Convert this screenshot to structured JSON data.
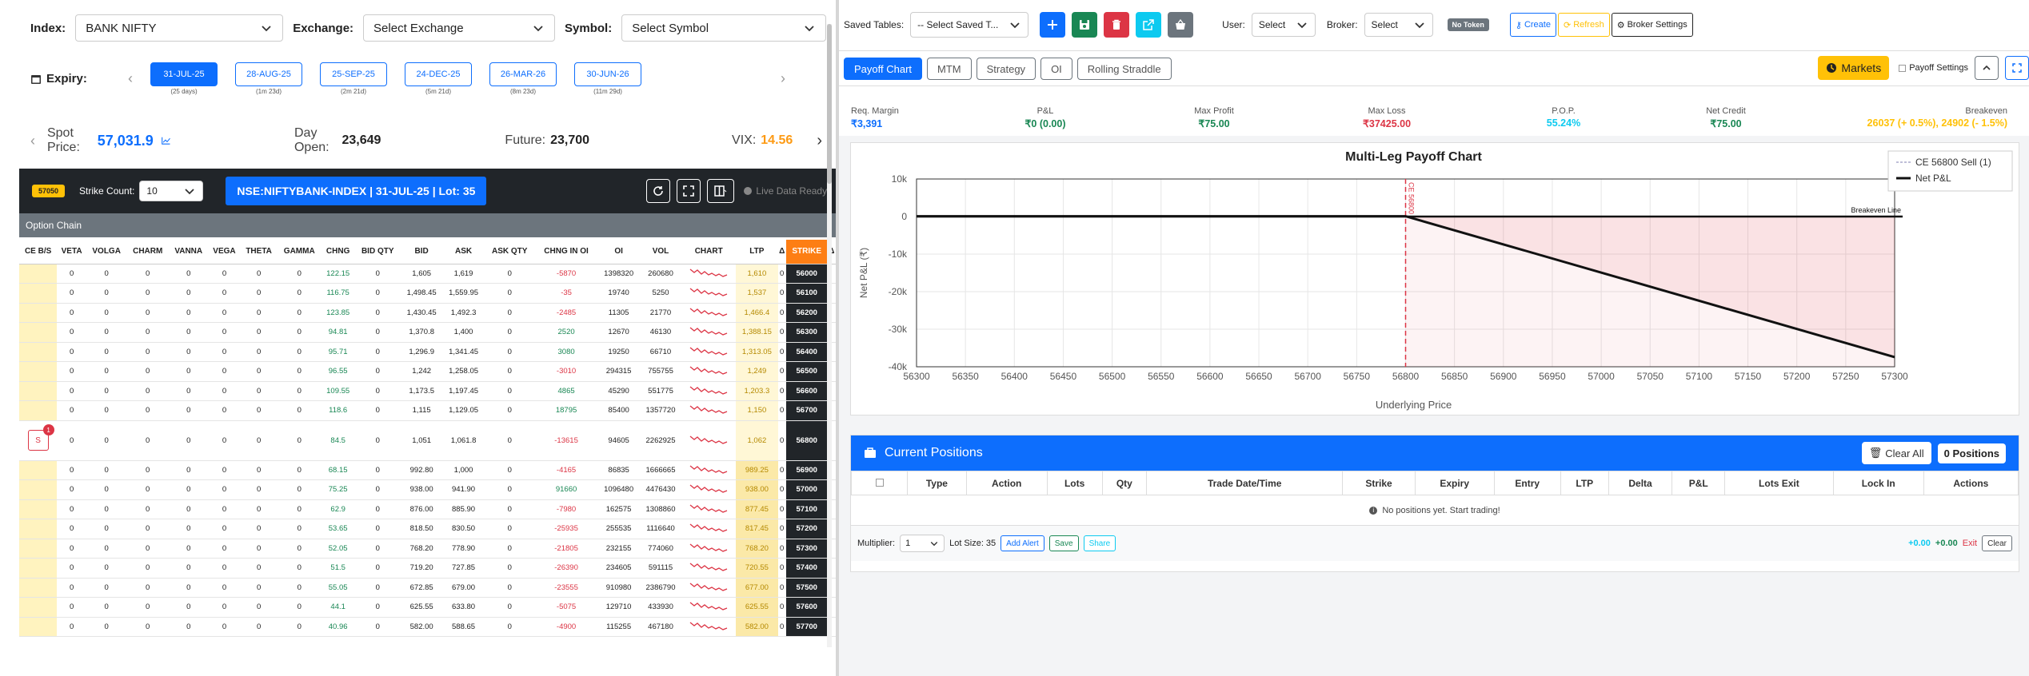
{
  "selectors": {
    "index_label": "Index:",
    "index_value": "BANK NIFTY",
    "exchange_label": "Exchange:",
    "exchange_value": "Select Exchange",
    "symbol_label": "Symbol:",
    "symbol_value": "Select Symbol"
  },
  "expiry": {
    "label": "Expiry:",
    "dates": [
      {
        "date": "31-JUL-25",
        "sub": "(25 days)"
      },
      {
        "date": "28-AUG-25",
        "sub": "(1m 23d)"
      },
      {
        "date": "25-SEP-25",
        "sub": "(2m 21d)"
      },
      {
        "date": "24-DEC-25",
        "sub": "(5m 21d)"
      },
      {
        "date": "26-MAR-26",
        "sub": "(8m 23d)"
      },
      {
        "date": "30-JUN-26",
        "sub": "(11m 29d)"
      }
    ]
  },
  "market": {
    "spot_label": "Spot Price:",
    "spot_value": "57,031.9",
    "day_open_label": "Day Open:",
    "day_open_value": "23,649",
    "future_label": "Future:",
    "future_value": "23,700",
    "vix_label": "VIX:",
    "vix_value": "14.56"
  },
  "chain_toolbar": {
    "badge": "57050",
    "strike_count_label": "Strike Count:",
    "strike_count_value": "10",
    "instrument": "NSE:NIFTYBANK-INDEX | 31-JUL-25 | Lot: 35",
    "live_status": "Live Data Ready",
    "section_title": "Option Chain"
  },
  "option_chain": {
    "headers": [
      "CE B/S",
      "VETA",
      "VOLGA",
      "CHARM",
      "VANNA",
      "VEGA",
      "THETA",
      "GAMMA",
      "CHNG",
      "BID QTY",
      "BID",
      "ASK",
      "ASK QTY",
      "CHNG IN OI",
      "OI",
      "VOL",
      "CHART",
      "LTP",
      "Δ",
      "STRIKE",
      "Δ"
    ],
    "rows": [
      {
        "chng": "122.15",
        "bid": "1,605",
        "ask": "1,619",
        "chng_oi": "-5870",
        "oi": "1398320",
        "vol": "260680",
        "ltp": "1,610",
        "strike": "56000"
      },
      {
        "chng": "116.75",
        "bid": "1,498.45",
        "ask": "1,559.95",
        "chng_oi": "-35",
        "oi": "19740",
        "vol": "5250",
        "ltp": "1,537",
        "strike": "56100"
      },
      {
        "chng": "123.85",
        "bid": "1,430.45",
        "ask": "1,492.3",
        "chng_oi": "-2485",
        "oi": "11305",
        "vol": "21770",
        "ltp": "1,466.4",
        "strike": "56200"
      },
      {
        "chng": "94.81",
        "bid": "1,370.8",
        "ask": "1,400",
        "chng_oi": "2520",
        "oi": "12670",
        "vol": "46130",
        "ltp": "1,388.15",
        "strike": "56300"
      },
      {
        "chng": "95.71",
        "bid": "1,296.9",
        "ask": "1,341.45",
        "chng_oi": "3080",
        "oi": "19250",
        "vol": "66710",
        "ltp": "1,313.05",
        "strike": "56400"
      },
      {
        "chng": "96.55",
        "bid": "1,242",
        "ask": "1,258.05",
        "chng_oi": "-3010",
        "oi": "294315",
        "vol": "755755",
        "ltp": "1,249",
        "strike": "56500"
      },
      {
        "chng": "109.55",
        "bid": "1,173.5",
        "ask": "1,197.45",
        "chng_oi": "4865",
        "oi": "45290",
        "vol": "551775",
        "ltp": "1,203.3",
        "strike": "56600"
      },
      {
        "chng": "118.6",
        "bid": "1,115",
        "ask": "1,129.05",
        "chng_oi": "18795",
        "oi": "85400",
        "vol": "1357720",
        "ltp": "1,150",
        "strike": "56700"
      },
      {
        "chng": "84.5",
        "bid": "1,051",
        "ask": "1,061.8",
        "chng_oi": "-13615",
        "oi": "94605",
        "vol": "2262925",
        "ltp": "1,062",
        "strike": "56800"
      },
      {
        "chng": "68.15",
        "bid": "992.80",
        "ask": "1,000",
        "chng_oi": "-4165",
        "oi": "86835",
        "vol": "1666665",
        "ltp": "989.25",
        "strike": "56900"
      },
      {
        "chng": "75.25",
        "bid": "938.00",
        "ask": "941.90",
        "chng_oi": "91660",
        "oi": "1096480",
        "vol": "4476430",
        "ltp": "938.00",
        "strike": "57000"
      },
      {
        "chng": "62.9",
        "bid": "876.00",
        "ask": "885.90",
        "chng_oi": "-7980",
        "oi": "162575",
        "vol": "1308860",
        "ltp": "877.45",
        "strike": "57100"
      },
      {
        "chng": "53.65",
        "bid": "818.50",
        "ask": "830.50",
        "chng_oi": "-25935",
        "oi": "255535",
        "vol": "1116640",
        "ltp": "817.45",
        "strike": "57200"
      },
      {
        "chng": "52.05",
        "bid": "768.20",
        "ask": "778.90",
        "chng_oi": "-21805",
        "oi": "232155",
        "vol": "774060",
        "ltp": "768.20",
        "strike": "57300"
      },
      {
        "chng": "51.5",
        "bid": "719.20",
        "ask": "727.85",
        "chng_oi": "-26390",
        "oi": "234605",
        "vol": "591115",
        "ltp": "720.55",
        "strike": "57400"
      },
      {
        "chng": "55.05",
        "bid": "672.85",
        "ask": "679.00",
        "chng_oi": "-23555",
        "oi": "910980",
        "vol": "2386790",
        "ltp": "677.00",
        "strike": "57500"
      },
      {
        "chng": "44.1",
        "bid": "625.55",
        "ask": "633.80",
        "chng_oi": "-5075",
        "oi": "129710",
        "vol": "433930",
        "ltp": "625.55",
        "strike": "57600"
      },
      {
        "chng": "40.96",
        "bid": "582.00",
        "ask": "588.65",
        "chng_oi": "-4900",
        "oi": "115255",
        "vol": "467180",
        "ltp": "582.00",
        "strike": "57700"
      }
    ],
    "zero_value": "0",
    "sell_label": "S",
    "sell_badge": "1"
  },
  "top_bar": {
    "saved_tables_label": "Saved Tables:",
    "saved_tables_value": "-- Select Saved T...",
    "user_label": "User:",
    "user_value": "Select",
    "broker_label": "Broker:",
    "broker_value": "Select",
    "no_token": "No Token",
    "create": "Create",
    "refresh": "Refresh",
    "broker_settings": "Broker Settings"
  },
  "tabs": [
    "Payoff Chart",
    "MTM",
    "Strategy",
    "OI",
    "Rolling Straddle"
  ],
  "tab_right": {
    "markets": "Markets",
    "payoff_settings": "Payoff Settings"
  },
  "metrics": [
    {
      "label": "Req. Margin",
      "value": "₹3,391",
      "color": "#0d6efd"
    },
    {
      "label": "P&L",
      "value": "₹0 (0.00)",
      "color": "#198754"
    },
    {
      "label": "Max Profit",
      "value": "₹75.00",
      "color": "#198754"
    },
    {
      "label": "Max Loss",
      "value": "₹37425.00",
      "color": "#dc3545"
    },
    {
      "label": "P.O.P.",
      "value": "55.24%",
      "color": "#0dcaf0"
    },
    {
      "label": "Net Credit",
      "value": "₹75.00",
      "color": "#198754"
    },
    {
      "label": "Breakeven",
      "value": "26037 (+ 0.5%), 24902 (- 1.5%)",
      "color": "#ffc107"
    }
  ],
  "chart_data": {
    "type": "line",
    "title": "Multi-Leg Payoff Chart",
    "xlabel": "Underlying Price",
    "ylabel": "Net P&L (₹)",
    "xlim": [
      56300,
      57300
    ],
    "ylim": [
      -40000,
      10000
    ],
    "x_ticks": [
      56300,
      56350,
      56400,
      56450,
      56500,
      56550,
      56600,
      56650,
      56700,
      56750,
      56800,
      56850,
      56900,
      56950,
      57000,
      57050,
      57100,
      57150,
      57200,
      57250,
      57300
    ],
    "y_ticks": [
      "10k",
      "0",
      "-10k",
      "-20k",
      "-30k",
      "-40k"
    ],
    "y_tick_values": [
      10000,
      0,
      -10000,
      -20000,
      -30000,
      -40000
    ],
    "series": [
      {
        "name": "Net P&L",
        "x": [
          56300,
          56800,
          57300
        ],
        "y": [
          75,
          75,
          -37425
        ]
      }
    ],
    "legend": [
      "CE 56800 Sell (1)",
      "Net P&L"
    ],
    "annotations": {
      "vertical_line_x": 56800,
      "vertical_label": "CE 56800",
      "breakeven_label": "Breakeven Line"
    },
    "grid": true,
    "legend_position": "top-right"
  },
  "positions": {
    "title": "Current Positions",
    "clear_all": "Clear All",
    "count": "0 Positions",
    "columns": [
      "Type",
      "Action",
      "Lots",
      "Qty",
      "Trade Date/Time",
      "Strike",
      "Expiry",
      "Entry",
      "LTP",
      "Delta",
      "P&L",
      "Lots Exit",
      "Lock In",
      "Actions"
    ],
    "empty": "No positions yet. Start trading!",
    "multiplier_label": "Multiplier:",
    "multiplier_value": "1",
    "lot_size": "Lot Size: 35",
    "add_alert": "Add Alert",
    "save": "Save",
    "share": "Share",
    "sum1": "+0.00",
    "sum2": "+0.00",
    "exit": "Exit",
    "clear": "Clear"
  }
}
